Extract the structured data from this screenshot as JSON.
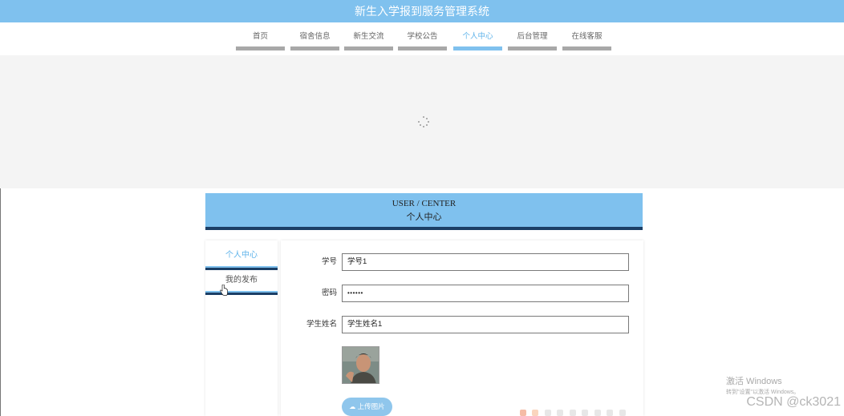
{
  "app": {
    "title": "新生入学报到服务管理系统"
  },
  "nav": {
    "items": [
      {
        "label": "首页"
      },
      {
        "label": "宿舍信息"
      },
      {
        "label": "新生交流"
      },
      {
        "label": "学校公告"
      },
      {
        "label": "个人中心"
      },
      {
        "label": "后台管理"
      },
      {
        "label": "在线客服"
      }
    ],
    "active_index": 4
  },
  "user_center": {
    "title_en": "USER / CENTER",
    "title_cn": "个人中心"
  },
  "sidebar": {
    "items": [
      {
        "label": "个人中心"
      },
      {
        "label": "我的发布"
      }
    ],
    "active_index": 0
  },
  "form": {
    "student_id": {
      "label": "学号",
      "value": "学号1"
    },
    "password": {
      "label": "密码",
      "value": "••••••"
    },
    "student_name": {
      "label": "学生姓名",
      "value": "学生姓名1"
    },
    "upload_label": "上传图片"
  },
  "overlay": {
    "activate_title": "激活 Windows",
    "activate_sub": "转到\"设置\"以激活 Windows。",
    "watermark": "CSDN @ck3021"
  },
  "colors": {
    "primary": "#7fc1ee",
    "dark": "#1b3f66",
    "banner_bg": "#f4f4f4"
  }
}
